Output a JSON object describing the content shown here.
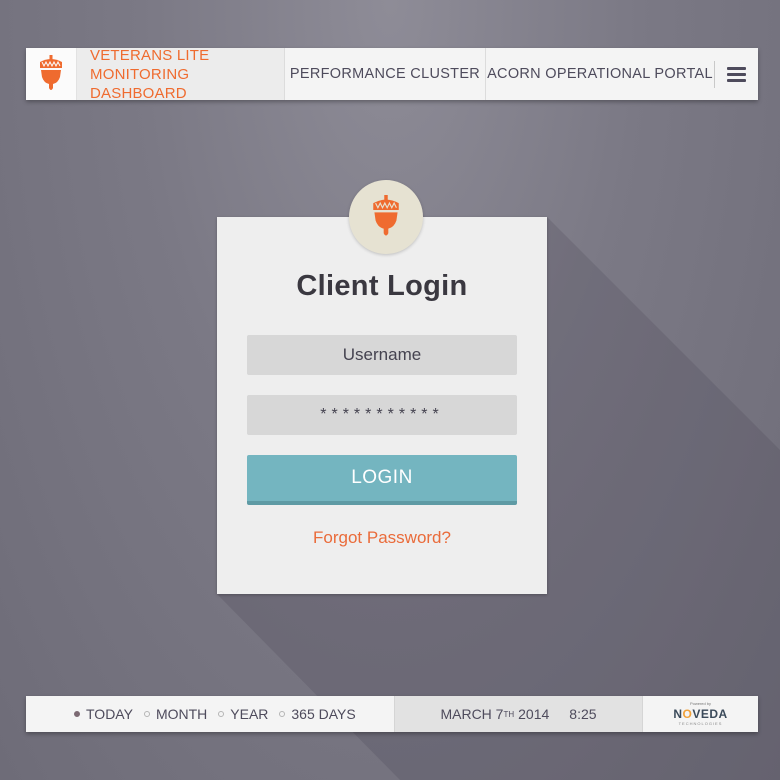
{
  "colors": {
    "accent_orange": "#ef6b2f",
    "login_button": "#74b5c0",
    "nav_text": "#4e4b5c",
    "background": "#7b7985"
  },
  "header": {
    "logo_icon": "acorn-icon",
    "brand_line1": "VETERANS LITE",
    "brand_line2": "MONITORING DASHBOARD",
    "nav": [
      {
        "label": "PERFORMANCE CLUSTER"
      },
      {
        "label": "ACORN OPERATIONAL PORTAL"
      }
    ],
    "menu_icon": "hamburger-menu-icon"
  },
  "login": {
    "avatar_icon": "acorn-icon",
    "title": "Client Login",
    "username_placeholder": "Username",
    "password_value": "***********",
    "button_label": "LOGIN",
    "forgot_label": "Forgot Password?"
  },
  "footer": {
    "periods": [
      {
        "label": "TODAY",
        "active": true
      },
      {
        "label": "MONTH",
        "active": false
      },
      {
        "label": "YEAR",
        "active": false
      },
      {
        "label": "365 DAYS",
        "active": false
      }
    ],
    "date_month_day": "MARCH 7",
    "date_suffix": "TH",
    "date_year": "2014",
    "time": "8:25",
    "brand_powered": "Powered by",
    "brand_name_start": "N",
    "brand_name_o": "O",
    "brand_name_end": "VEDA",
    "brand_sub": "TECHNOLOGIES"
  }
}
